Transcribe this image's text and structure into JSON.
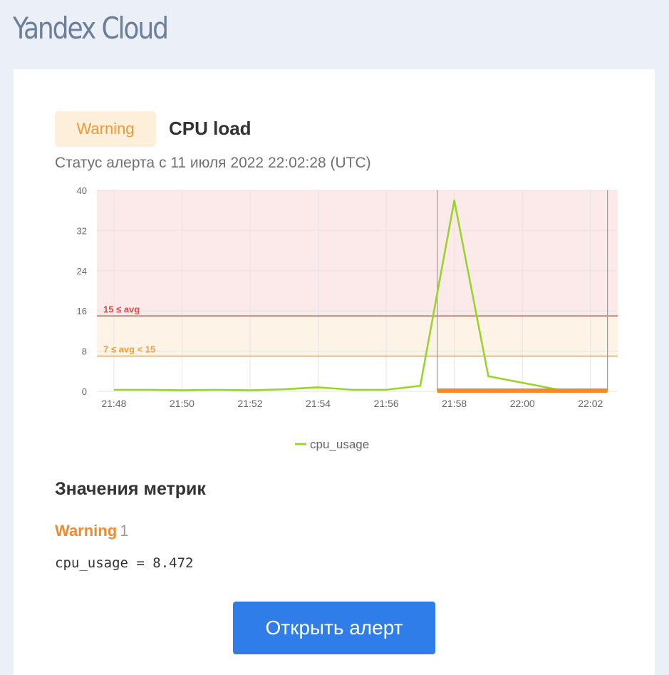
{
  "logo": {
    "text": "Yandex Cloud"
  },
  "alert": {
    "status": "Warning",
    "name": "CPU load",
    "status_since": "Статус алерта с 11 июля 2022 22:02:28 (UTC)"
  },
  "chart_data": {
    "type": "line",
    "x_ticks": [
      "21:48",
      "21:50",
      "21:52",
      "21:54",
      "21:56",
      "21:58",
      "22:00",
      "22:02"
    ],
    "y_ticks": [
      0,
      8,
      16,
      24,
      32,
      40
    ],
    "xlim": [
      "21:47.5",
      "22:02.8"
    ],
    "ylim": [
      0,
      40
    ],
    "grid": true,
    "legend_position": "bottom",
    "series": [
      {
        "name": "cpu_usage",
        "color": "#9ad42a",
        "x": [
          "21:48",
          "21:49",
          "21:50",
          "21:51",
          "21:52",
          "21:53",
          "21:54",
          "21:55",
          "21:56",
          "21:57",
          "21:58",
          "21:59",
          "22:00",
          "22:01"
        ],
        "values": [
          0.3,
          0.3,
          0.2,
          0.3,
          0.2,
          0.4,
          0.8,
          0.3,
          0.3,
          1.1,
          38.0,
          3.0,
          1.7,
          0.4
        ]
      }
    ],
    "thresholds": [
      {
        "label": "15 ≤ avg",
        "value": 15,
        "color": "#e34a4a",
        "zone_color": "#fce9e9"
      },
      {
        "label": "7 ≤ avg < 15",
        "value": 7,
        "color": "#f0a03c",
        "zone_color": "#fdf3e6"
      }
    ],
    "alert_window": {
      "start": "21:57.5",
      "end": "22:02.5",
      "color": "#f28a2a"
    }
  },
  "metrics": {
    "title": "Значения метрик",
    "status": "Warning",
    "count": "1",
    "line": "cpu_usage = 8.472"
  },
  "button": {
    "label": "Открыть алерт"
  }
}
